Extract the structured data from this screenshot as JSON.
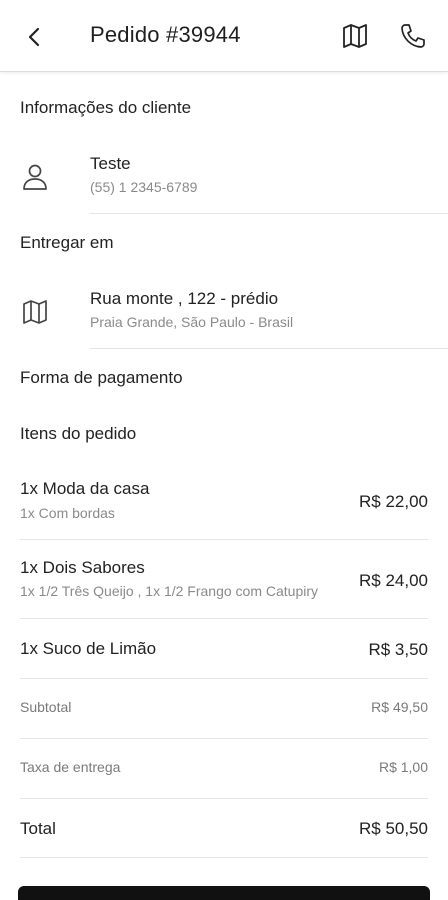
{
  "header": {
    "title": "Pedido #39944",
    "back_icon": "arrow-back-icon",
    "map_icon": "map-icon",
    "phone_icon": "phone-icon"
  },
  "customer": {
    "section_title": "Informações do cliente",
    "name": "Teste",
    "phone": "(55) 1 2345-6789",
    "icon": "person-icon"
  },
  "delivery": {
    "section_title": "Entregar em",
    "address": "Rua monte , 122 - prédio",
    "city": "Praia Grande, São Paulo - Brasil",
    "icon": "map-icon"
  },
  "payment": {
    "section_title": "Forma de pagamento"
  },
  "items": {
    "section_title": "Itens do pedido",
    "list": [
      {
        "name": "1x Moda da casa",
        "desc": "1x Com bordas",
        "price": "R$ 22,00"
      },
      {
        "name": "1x Dois Sabores",
        "desc": "1x 1/2 Três Queijo , 1x 1/2 Frango com Catupiry",
        "price": "R$ 24,00"
      },
      {
        "name": "1x Suco de Limão",
        "desc": "",
        "price": "R$ 3,50"
      }
    ]
  },
  "summary": {
    "subtotal_label": "Subtotal",
    "subtotal_value": "R$ 49,50",
    "fee_label": "Taxa de entrega",
    "fee_value": "R$ 1,00",
    "total_label": "Total",
    "total_value": "R$ 50,50"
  }
}
